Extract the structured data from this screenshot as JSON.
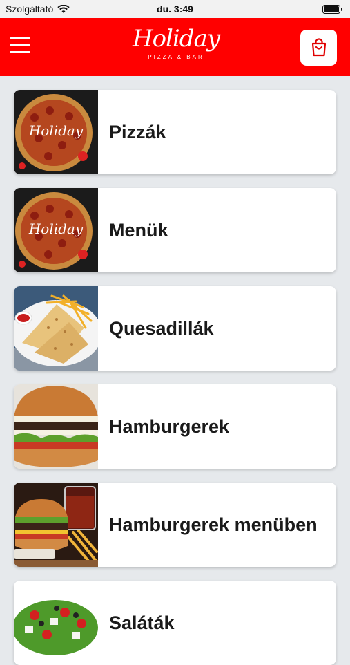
{
  "status_bar": {
    "carrier": "Szolgáltató",
    "time": "du. 3:49"
  },
  "header": {
    "logo_text": "Holiday",
    "logo_subtitle": "PIZZA & BAR"
  },
  "categories": [
    {
      "label": "Pizzák",
      "image": "pizza"
    },
    {
      "label": "Menük",
      "image": "pizza"
    },
    {
      "label": "Quesadillák",
      "image": "quesadilla"
    },
    {
      "label": "Hamburgerek",
      "image": "burger"
    },
    {
      "label": "Hamburgerek menüben",
      "image": "burger-menu"
    },
    {
      "label": "Saláták",
      "image": "salad"
    }
  ],
  "colors": {
    "brand_red": "#ff0000",
    "background": "#e6e9ec"
  }
}
